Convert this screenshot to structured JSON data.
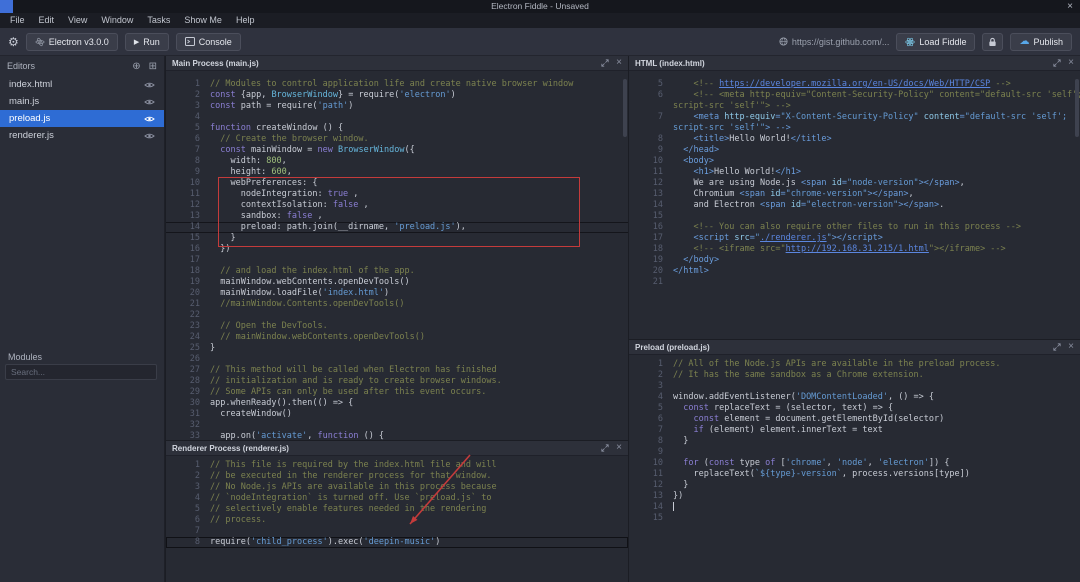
{
  "titlebar": {
    "title": "Electron Fiddle - Unsaved",
    "menus": [
      "File",
      "Edit",
      "View",
      "Window",
      "Tasks",
      "Show Me",
      "Help"
    ]
  },
  "icons": {
    "gear": "⚙",
    "play": "▶",
    "cloud": "☁",
    "add": "⊕",
    "grid": "⊞",
    "close": "×",
    "window_close": "×"
  },
  "toolbar": {
    "version_label": "Electron v3.0.0",
    "run_label": "Run",
    "console_label": "Console",
    "gist_url": "https://gist.github.com/...",
    "load_fiddle_label": "Load Fiddle",
    "publish_label": "Publish"
  },
  "sidebar": {
    "editors_title": "Editors",
    "files": [
      {
        "name": "index.html",
        "selected": false
      },
      {
        "name": "main.js",
        "selected": false
      },
      {
        "name": "preload.js",
        "selected": true
      },
      {
        "name": "renderer.js",
        "selected": false
      }
    ],
    "modules_title": "Modules",
    "search_placeholder": "Search..."
  },
  "panels": [
    {
      "id": "main",
      "title": "Main Process (main.js)",
      "current_line": 14,
      "lines": [
        {
          "n": 1,
          "t": [
            [
              "c",
              "// Modules to control application life and create native browser window"
            ]
          ]
        },
        {
          "n": 2,
          "t": [
            [
              "k",
              "const "
            ],
            [
              "p",
              "{app, "
            ],
            [
              "y",
              "BrowserWindow"
            ],
            [
              "p",
              "} = require("
            ],
            [
              "s",
              "'electron'"
            ],
            [
              "p",
              ")"
            ]
          ]
        },
        {
          "n": 3,
          "t": [
            [
              "k",
              "const "
            ],
            [
              "p",
              "path = require("
            ],
            [
              "s",
              "'path'"
            ],
            [
              "p",
              ")"
            ]
          ]
        },
        {
          "n": 4,
          "t": []
        },
        {
          "n": 5,
          "t": [
            [
              "k",
              "function "
            ],
            [
              "p",
              "createWindow () {"
            ]
          ]
        },
        {
          "n": 6,
          "t": [
            [
              "c",
              "  // Create the browser window."
            ]
          ]
        },
        {
          "n": 7,
          "t": [
            [
              "p",
              "  "
            ],
            [
              "k",
              "const "
            ],
            [
              "p",
              "mainWindow = "
            ],
            [
              "k",
              "new "
            ],
            [
              "y",
              "BrowserWindow"
            ],
            [
              "p",
              "({"
            ]
          ]
        },
        {
          "n": 8,
          "t": [
            [
              "p",
              "    width: "
            ],
            [
              "n",
              "800"
            ],
            [
              "p",
              ","
            ]
          ]
        },
        {
          "n": 9,
          "t": [
            [
              "p",
              "    height: "
            ],
            [
              "n",
              "600"
            ],
            [
              "p",
              ","
            ]
          ]
        },
        {
          "n": 10,
          "t": [
            [
              "p",
              "    webPreferences: {"
            ]
          ]
        },
        {
          "n": 11,
          "t": [
            [
              "p",
              "      nodeIntegration: "
            ],
            [
              "k",
              "true"
            ],
            [
              "p",
              " ,"
            ]
          ]
        },
        {
          "n": 12,
          "t": [
            [
              "p",
              "      contextIsolation: "
            ],
            [
              "k",
              "false"
            ],
            [
              "p",
              " ,"
            ]
          ]
        },
        {
          "n": 13,
          "t": [
            [
              "p",
              "      sandbox: "
            ],
            [
              "k",
              "false"
            ],
            [
              "p",
              " ,"
            ]
          ]
        },
        {
          "n": 14,
          "t": [
            [
              "p",
              "      preload: path.join(__dirname, "
            ],
            [
              "s",
              "'preload.js'"
            ],
            [
              "p",
              "),"
            ]
          ]
        },
        {
          "n": 15,
          "t": [
            [
              "p",
              "    }"
            ]
          ]
        },
        {
          "n": 16,
          "t": [
            [
              "p",
              "  })"
            ]
          ]
        },
        {
          "n": 17,
          "t": []
        },
        {
          "n": 18,
          "t": [
            [
              "c",
              "  // and load the index.html of the app."
            ]
          ]
        },
        {
          "n": 19,
          "t": [
            [
              "p",
              "  mainWindow.webContents.openDevTools()"
            ]
          ]
        },
        {
          "n": 20,
          "t": [
            [
              "p",
              "  mainWindow.loadFile("
            ],
            [
              "s",
              "'index.html'"
            ],
            [
              "p",
              ")"
            ]
          ]
        },
        {
          "n": 21,
          "t": [
            [
              "c",
              "  //mainWindow.Contents.openDevTools()"
            ]
          ]
        },
        {
          "n": 22,
          "t": []
        },
        {
          "n": 23,
          "t": [
            [
              "c",
              "  // Open the DevTools."
            ]
          ]
        },
        {
          "n": 24,
          "t": [
            [
              "c",
              "  // mainWindow.webContents.openDevTools()"
            ]
          ]
        },
        {
          "n": 25,
          "t": [
            [
              "p",
              "}"
            ]
          ]
        },
        {
          "n": 26,
          "t": []
        },
        {
          "n": 27,
          "t": [
            [
              "c",
              "// This method will be called when Electron has finished"
            ]
          ]
        },
        {
          "n": 28,
          "t": [
            [
              "c",
              "// initialization and is ready to create browser windows."
            ]
          ]
        },
        {
          "n": 29,
          "t": [
            [
              "c",
              "// Some APIs can only be used after this event occurs."
            ]
          ]
        },
        {
          "n": 30,
          "t": [
            [
              "p",
              "app.whenReady().then(() => {"
            ]
          ]
        },
        {
          "n": 31,
          "t": [
            [
              "p",
              "  createWindow()"
            ]
          ]
        },
        {
          "n": 32,
          "t": []
        },
        {
          "n": 33,
          "t": [
            [
              "p",
              "  app.on("
            ],
            [
              "s",
              "'activate'"
            ],
            [
              "p",
              ", "
            ],
            [
              "k",
              "function"
            ],
            [
              "p",
              " () {"
            ]
          ]
        }
      ]
    },
    {
      "id": "renderer",
      "title": "Renderer Process (renderer.js)",
      "current_line": 8,
      "lines": [
        {
          "n": 1,
          "t": [
            [
              "c",
              "// This file is required by the index.html file and will"
            ]
          ]
        },
        {
          "n": 2,
          "t": [
            [
              "c",
              "// be executed in the renderer process for that window."
            ]
          ]
        },
        {
          "n": 3,
          "t": [
            [
              "c",
              "// No Node.js APIs are available in this process because"
            ]
          ]
        },
        {
          "n": 4,
          "t": [
            [
              "c",
              "// `nodeIntegration` is turned off. Use `preload.js` to"
            ]
          ]
        },
        {
          "n": 5,
          "t": [
            [
              "c",
              "// selectively enable features needed in the rendering"
            ]
          ]
        },
        {
          "n": 6,
          "t": [
            [
              "c",
              "// process."
            ]
          ]
        },
        {
          "n": 7,
          "t": []
        },
        {
          "n": 8,
          "t": [
            [
              "p",
              "require("
            ],
            [
              "s",
              "'child_process'"
            ],
            [
              "p",
              ").exec("
            ],
            [
              "s",
              "'deepin-music'"
            ],
            [
              "p",
              ")"
            ]
          ]
        }
      ]
    },
    {
      "id": "html",
      "title": "HTML (index.html)",
      "lines": [
        {
          "n": 5,
          "t": [
            [
              "c",
              "    <!-- "
            ],
            [
              "l",
              "https://developer.mozilla.org/en-US/docs/Web/HTTP/CSP"
            ],
            [
              "c",
              " -->"
            ]
          ]
        },
        {
          "n": 6,
          "t": [
            [
              "c",
              "    <!-- <meta http-equiv=\"Content-Security-Policy\" content=\"default-src 'self';"
            ]
          ]
        },
        {
          "n": "",
          "t": [
            [
              "c",
              "script-src 'self'\"> -->"
            ]
          ]
        },
        {
          "n": 7,
          "t": [
            [
              "g",
              "    <meta "
            ],
            [
              "a",
              "http-equiv"
            ],
            [
              "g",
              "="
            ],
            [
              "s",
              "\"X-Content-Security-Policy\""
            ],
            [
              "g",
              " "
            ],
            [
              "a",
              "content"
            ],
            [
              "g",
              "="
            ],
            [
              "s",
              "\"default-src 'self';"
            ]
          ]
        },
        {
          "n": "",
          "t": [
            [
              "s",
              "script-src 'self'\""
            ],
            [
              "g",
              "> -->"
            ]
          ]
        },
        {
          "n": 8,
          "t": [
            [
              "g",
              "    <title>"
            ],
            [
              "p",
              "Hello World!"
            ],
            [
              "g",
              "</title>"
            ]
          ]
        },
        {
          "n": 9,
          "t": [
            [
              "g",
              "  </head>"
            ]
          ]
        },
        {
          "n": 10,
          "t": [
            [
              "g",
              "  <body>"
            ]
          ]
        },
        {
          "n": 11,
          "t": [
            [
              "g",
              "    <h1>"
            ],
            [
              "p",
              "Hello World!"
            ],
            [
              "g",
              "</h1>"
            ]
          ]
        },
        {
          "n": 12,
          "t": [
            [
              "p",
              "    We are using Node.js "
            ],
            [
              "g",
              "<span "
            ],
            [
              "a",
              "id"
            ],
            [
              "g",
              "="
            ],
            [
              "s",
              "\"node-version\""
            ],
            [
              "g",
              "></span>"
            ],
            [
              "p",
              ","
            ]
          ]
        },
        {
          "n": 13,
          "t": [
            [
              "p",
              "    Chromium "
            ],
            [
              "g",
              "<span "
            ],
            [
              "a",
              "id"
            ],
            [
              "g",
              "="
            ],
            [
              "s",
              "\"chrome-version\""
            ],
            [
              "g",
              "></span>"
            ],
            [
              "p",
              ","
            ]
          ]
        },
        {
          "n": 14,
          "t": [
            [
              "p",
              "    and Electron "
            ],
            [
              "g",
              "<span "
            ],
            [
              "a",
              "id"
            ],
            [
              "g",
              "="
            ],
            [
              "s",
              "\"electron-version\""
            ],
            [
              "g",
              "></span>"
            ],
            [
              "p",
              "."
            ]
          ]
        },
        {
          "n": 15,
          "t": []
        },
        {
          "n": 16,
          "t": [
            [
              "c",
              "    <!-- You can also require other files to run in this process -->"
            ]
          ]
        },
        {
          "n": 17,
          "t": [
            [
              "g",
              "    <script "
            ],
            [
              "a",
              "src"
            ],
            [
              "g",
              "="
            ],
            [
              "s",
              "\""
            ],
            [
              "l",
              "./renderer.js"
            ],
            [
              "s",
              "\""
            ],
            [
              "g",
              "></script>"
            ]
          ]
        },
        {
          "n": 18,
          "t": [
            [
              "c",
              "    <!-- <iframe src=\""
            ],
            [
              "l",
              "http://192.168.31.215/1.html"
            ],
            [
              "c",
              "\"></iframe> -->"
            ]
          ]
        },
        {
          "n": 19,
          "t": [
            [
              "g",
              "  </body>"
            ]
          ]
        },
        {
          "n": 20,
          "t": [
            [
              "g",
              "</html>"
            ]
          ]
        },
        {
          "n": 21,
          "t": []
        }
      ]
    },
    {
      "id": "preload",
      "title": "Preload (preload.js)",
      "cursor_line": 14,
      "lines": [
        {
          "n": 1,
          "t": [
            [
              "c",
              "// All of the Node.js APIs are available in the preload process."
            ]
          ]
        },
        {
          "n": 2,
          "t": [
            [
              "c",
              "// It has the same sandbox as a Chrome extension."
            ]
          ]
        },
        {
          "n": 3,
          "t": []
        },
        {
          "n": 4,
          "t": [
            [
              "p",
              "window.addEventListener("
            ],
            [
              "s",
              "'DOMContentLoaded'"
            ],
            [
              "p",
              ", () => {"
            ]
          ]
        },
        {
          "n": 5,
          "t": [
            [
              "p",
              "  "
            ],
            [
              "k",
              "const"
            ],
            [
              "p",
              " replaceText = (selector, text) => {"
            ]
          ]
        },
        {
          "n": 6,
          "t": [
            [
              "p",
              "    "
            ],
            [
              "k",
              "const"
            ],
            [
              "p",
              " element = document.getElementById(selector)"
            ]
          ]
        },
        {
          "n": 7,
          "t": [
            [
              "p",
              "    "
            ],
            [
              "k",
              "if"
            ],
            [
              "p",
              " (element) element.innerText = text"
            ]
          ]
        },
        {
          "n": 8,
          "t": [
            [
              "p",
              "  }"
            ]
          ]
        },
        {
          "n": 9,
          "t": []
        },
        {
          "n": 10,
          "t": [
            [
              "p",
              "  "
            ],
            [
              "k",
              "for"
            ],
            [
              "p",
              " ("
            ],
            [
              "k",
              "const"
            ],
            [
              "p",
              " type "
            ],
            [
              "k",
              "of"
            ],
            [
              "p",
              " ["
            ],
            [
              "s",
              "'chrome'"
            ],
            [
              "p",
              ", "
            ],
            [
              "s",
              "'node'"
            ],
            [
              "p",
              ", "
            ],
            [
              "s",
              "'electron'"
            ],
            [
              "p",
              "]) {"
            ]
          ]
        },
        {
          "n": 11,
          "t": [
            [
              "p",
              "    replaceText("
            ],
            [
              "s",
              "`${type}-version`"
            ],
            [
              "p",
              ", process.versions[type])"
            ]
          ]
        },
        {
          "n": 12,
          "t": [
            [
              "p",
              "  }"
            ]
          ]
        },
        {
          "n": 13,
          "t": [
            [
              "p",
              "})"
            ]
          ]
        },
        {
          "n": 14,
          "t": []
        },
        {
          "n": 15,
          "t": []
        }
      ]
    }
  ]
}
